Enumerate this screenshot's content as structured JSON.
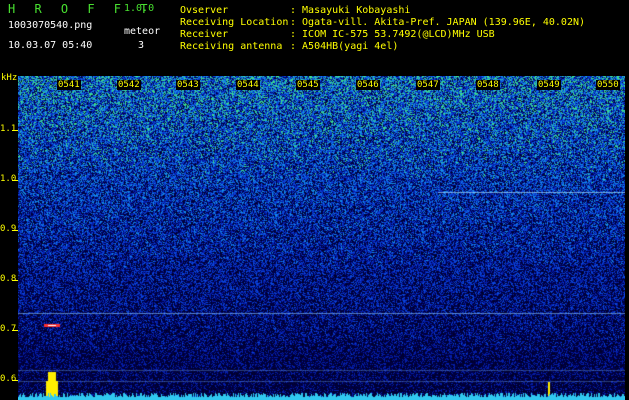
{
  "app": {
    "name": "H R O F F T",
    "version": "1.0.0"
  },
  "file": {
    "name": "1003070540.png",
    "datetime": "10.03.07 05:40"
  },
  "meteor": {
    "label": "meteor",
    "count": "3"
  },
  "info": {
    "observer_label": "Ovserver",
    "observer_value": ": Masayuki Kobayashi",
    "location_label": "Receiving Location",
    "location_value": ": Ogata-vill. Akita-Pref. JAPAN (139.96E, 40.02N)",
    "receiver_label": "Receiver",
    "receiver_value": ": ICOM IC-575 53.7492(@LCD)MHz USB",
    "antenna_label": "Receiving antenna",
    "antenna_value": ": A504HB(yagi 4el)"
  },
  "axis": {
    "y_unit": "kHz",
    "y_ticks": [
      "1.1",
      "1.0",
      "0.9",
      "0.8",
      "0.7",
      "0.6"
    ],
    "x_ticks": [
      "0541",
      "0542",
      "0543",
      "0544",
      "0545",
      "0546",
      "0547",
      "0548",
      "0549",
      "0550"
    ]
  },
  "colors": {
    "accent_green": "#48e030",
    "axis_yellow": "#ffff00",
    "background": "#000000"
  }
}
